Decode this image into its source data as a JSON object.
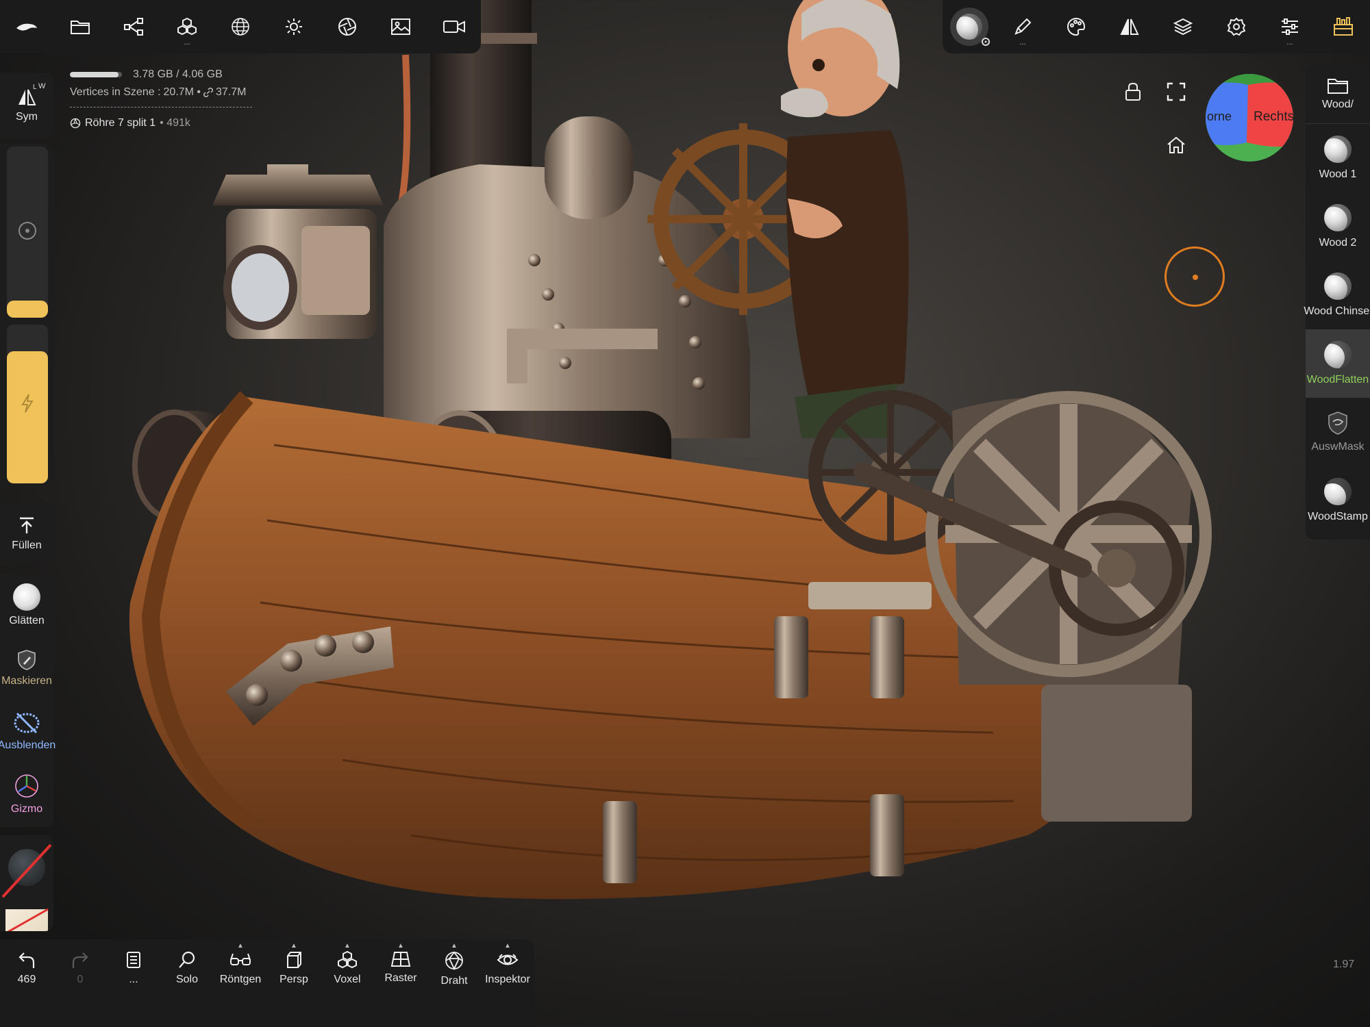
{
  "stats": {
    "memory": "3.78 GB / 4.06 GB",
    "memory_fraction": 0.93,
    "vertices_label": "Vertices in Szene :",
    "vertices_value": "20.7M •",
    "linked_value": "37.7M",
    "object_name": "Röhre 7 split 1",
    "object_count": "• 491k"
  },
  "left_panel": {
    "sym_label": "Sym",
    "sym_badge_l": "L",
    "sym_badge_w": "W",
    "size_value": 0.1,
    "intensity_value": 0.83,
    "fill_label": "Füllen",
    "smooth_label": "Glätten",
    "mask_label": "Maskieren",
    "hide_label": "Ausblenden",
    "gizmo_label": "Gizmo"
  },
  "right_panel": {
    "folder_label": "Wood/",
    "tools": [
      {
        "label": "Wood 1"
      },
      {
        "label": "Wood 2"
      },
      {
        "label": "Wood Chinsel"
      },
      {
        "label": "WoodFlatten"
      },
      {
        "label": "AuswMask"
      },
      {
        "label": "WoodStamp"
      }
    ]
  },
  "nav_cube": {
    "front_label": "orne",
    "right_label": "Rechts"
  },
  "bottom": {
    "undo_count": "469",
    "redo_count": "0",
    "more_label": "...",
    "solo": "Solo",
    "xray": "Röntgen",
    "persp": "Persp",
    "voxel": "Voxel",
    "grid": "Raster",
    "wire": "Draht",
    "inspector": "Inspektor"
  },
  "zoom_value": "1.97",
  "colors": {
    "accent": "#f0c35a",
    "green": "#8ecf5a",
    "blue": "#8fb8ff",
    "pink": "#f0a0e0",
    "orange": "#e07d20",
    "cube_red": "#ee4444",
    "cube_blue": "#4d7cf2",
    "cube_green": "#4caf50"
  }
}
